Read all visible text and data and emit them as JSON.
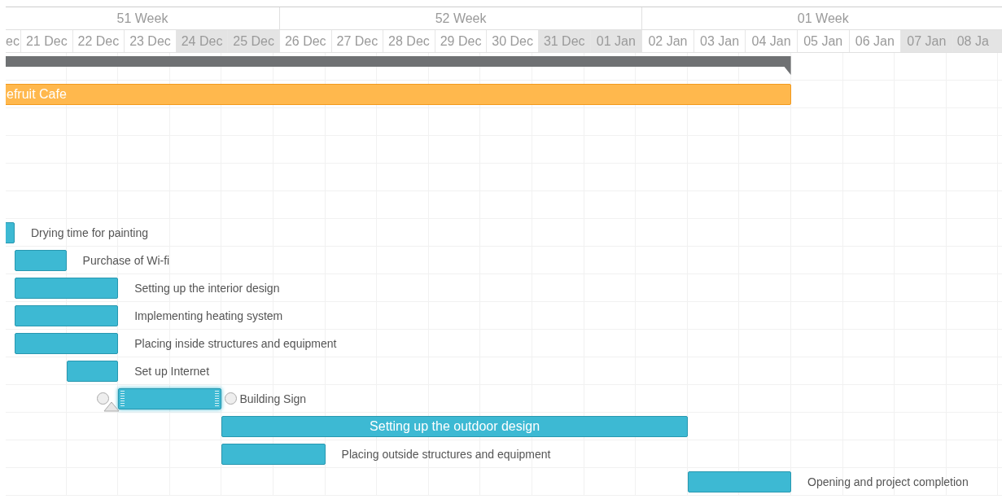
{
  "timeline": {
    "weeks": [
      {
        "label": "51 Week"
      },
      {
        "label": "52 Week"
      },
      {
        "label": "01 Week"
      }
    ],
    "days": [
      {
        "label": "ec",
        "weekend": false
      },
      {
        "label": "21 Dec",
        "weekend": false
      },
      {
        "label": "22 Dec",
        "weekend": false
      },
      {
        "label": "23 Dec",
        "weekend": false
      },
      {
        "label": "24 Dec",
        "weekend": true
      },
      {
        "label": "25 Dec",
        "weekend": true
      },
      {
        "label": "26 Dec",
        "weekend": false
      },
      {
        "label": "27 Dec",
        "weekend": false
      },
      {
        "label": "28 Dec",
        "weekend": false
      },
      {
        "label": "29 Dec",
        "weekend": false
      },
      {
        "label": "30 Dec",
        "weekend": false
      },
      {
        "label": "31 Dec",
        "weekend": true
      },
      {
        "label": "01 Jan",
        "weekend": true
      },
      {
        "label": "02 Jan",
        "weekend": false
      },
      {
        "label": "03 Jan",
        "weekend": false
      },
      {
        "label": "04 Jan",
        "weekend": false
      },
      {
        "label": "05 Jan",
        "weekend": false
      },
      {
        "label": "06 Jan",
        "weekend": false
      },
      {
        "label": "07 Jan",
        "weekend": true
      },
      {
        "label": "08 Ja",
        "weekend": true
      }
    ]
  },
  "tasks": [
    {
      "kind": "summary"
    },
    {
      "kind": "project",
      "label": "efruit Cafe",
      "label_inside": true,
      "selected": false
    },
    {
      "kind": "empty"
    },
    {
      "kind": "empty"
    },
    {
      "kind": "empty"
    },
    {
      "kind": "empty"
    },
    {
      "kind": "task",
      "label": "Drying time for painting",
      "label_inside": false,
      "selected": false
    },
    {
      "kind": "task",
      "label": "Purchase of Wi-fi",
      "label_inside": false,
      "selected": false
    },
    {
      "kind": "task",
      "label": "Setting up the interior design",
      "label_inside": false,
      "selected": false
    },
    {
      "kind": "task",
      "label": "Implementing heating system",
      "label_inside": false,
      "selected": false
    },
    {
      "kind": "task",
      "label": "Placing inside structures and equipment",
      "label_inside": false,
      "selected": false
    },
    {
      "kind": "task",
      "label": "Set up Internet",
      "label_inside": false,
      "selected": false
    },
    {
      "kind": "task",
      "label": "Building Sign",
      "label_inside": false,
      "selected": true
    },
    {
      "kind": "task",
      "label": "Setting up the outdoor design",
      "label_inside": true,
      "selected": false
    },
    {
      "kind": "task",
      "label": "Placing outside structures and equipment",
      "label_inside": false,
      "selected": false
    },
    {
      "kind": "task",
      "label": "Opening and project completion",
      "label_inside": false,
      "selected": false
    }
  ]
}
